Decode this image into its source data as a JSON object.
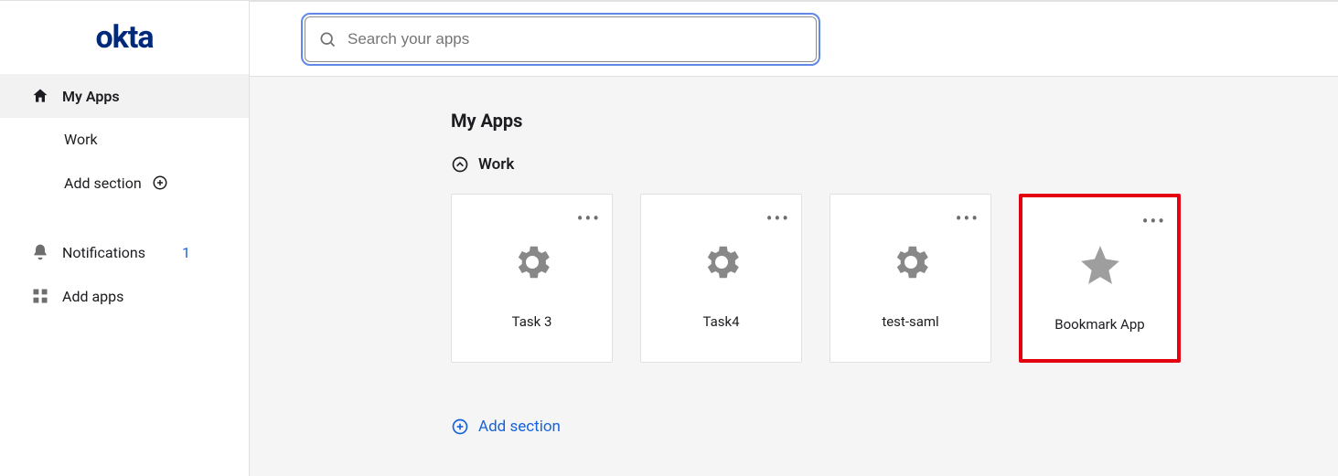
{
  "logo": "okta",
  "sidebar": {
    "my_apps": "My Apps",
    "items": [
      {
        "label": "Work"
      }
    ],
    "add_section": "Add section",
    "notifications": "Notifications",
    "notifications_badge": "1",
    "add_apps": "Add apps"
  },
  "search": {
    "placeholder": "Search your apps"
  },
  "main": {
    "title": "My Apps",
    "section": "Work",
    "apps": [
      {
        "label": "Task 3",
        "icon": "gear"
      },
      {
        "label": "Task4",
        "icon": "gear"
      },
      {
        "label": "test-saml",
        "icon": "gear"
      },
      {
        "label": "Bookmark App",
        "icon": "star",
        "highlight": true
      }
    ],
    "add_section": "Add section"
  }
}
